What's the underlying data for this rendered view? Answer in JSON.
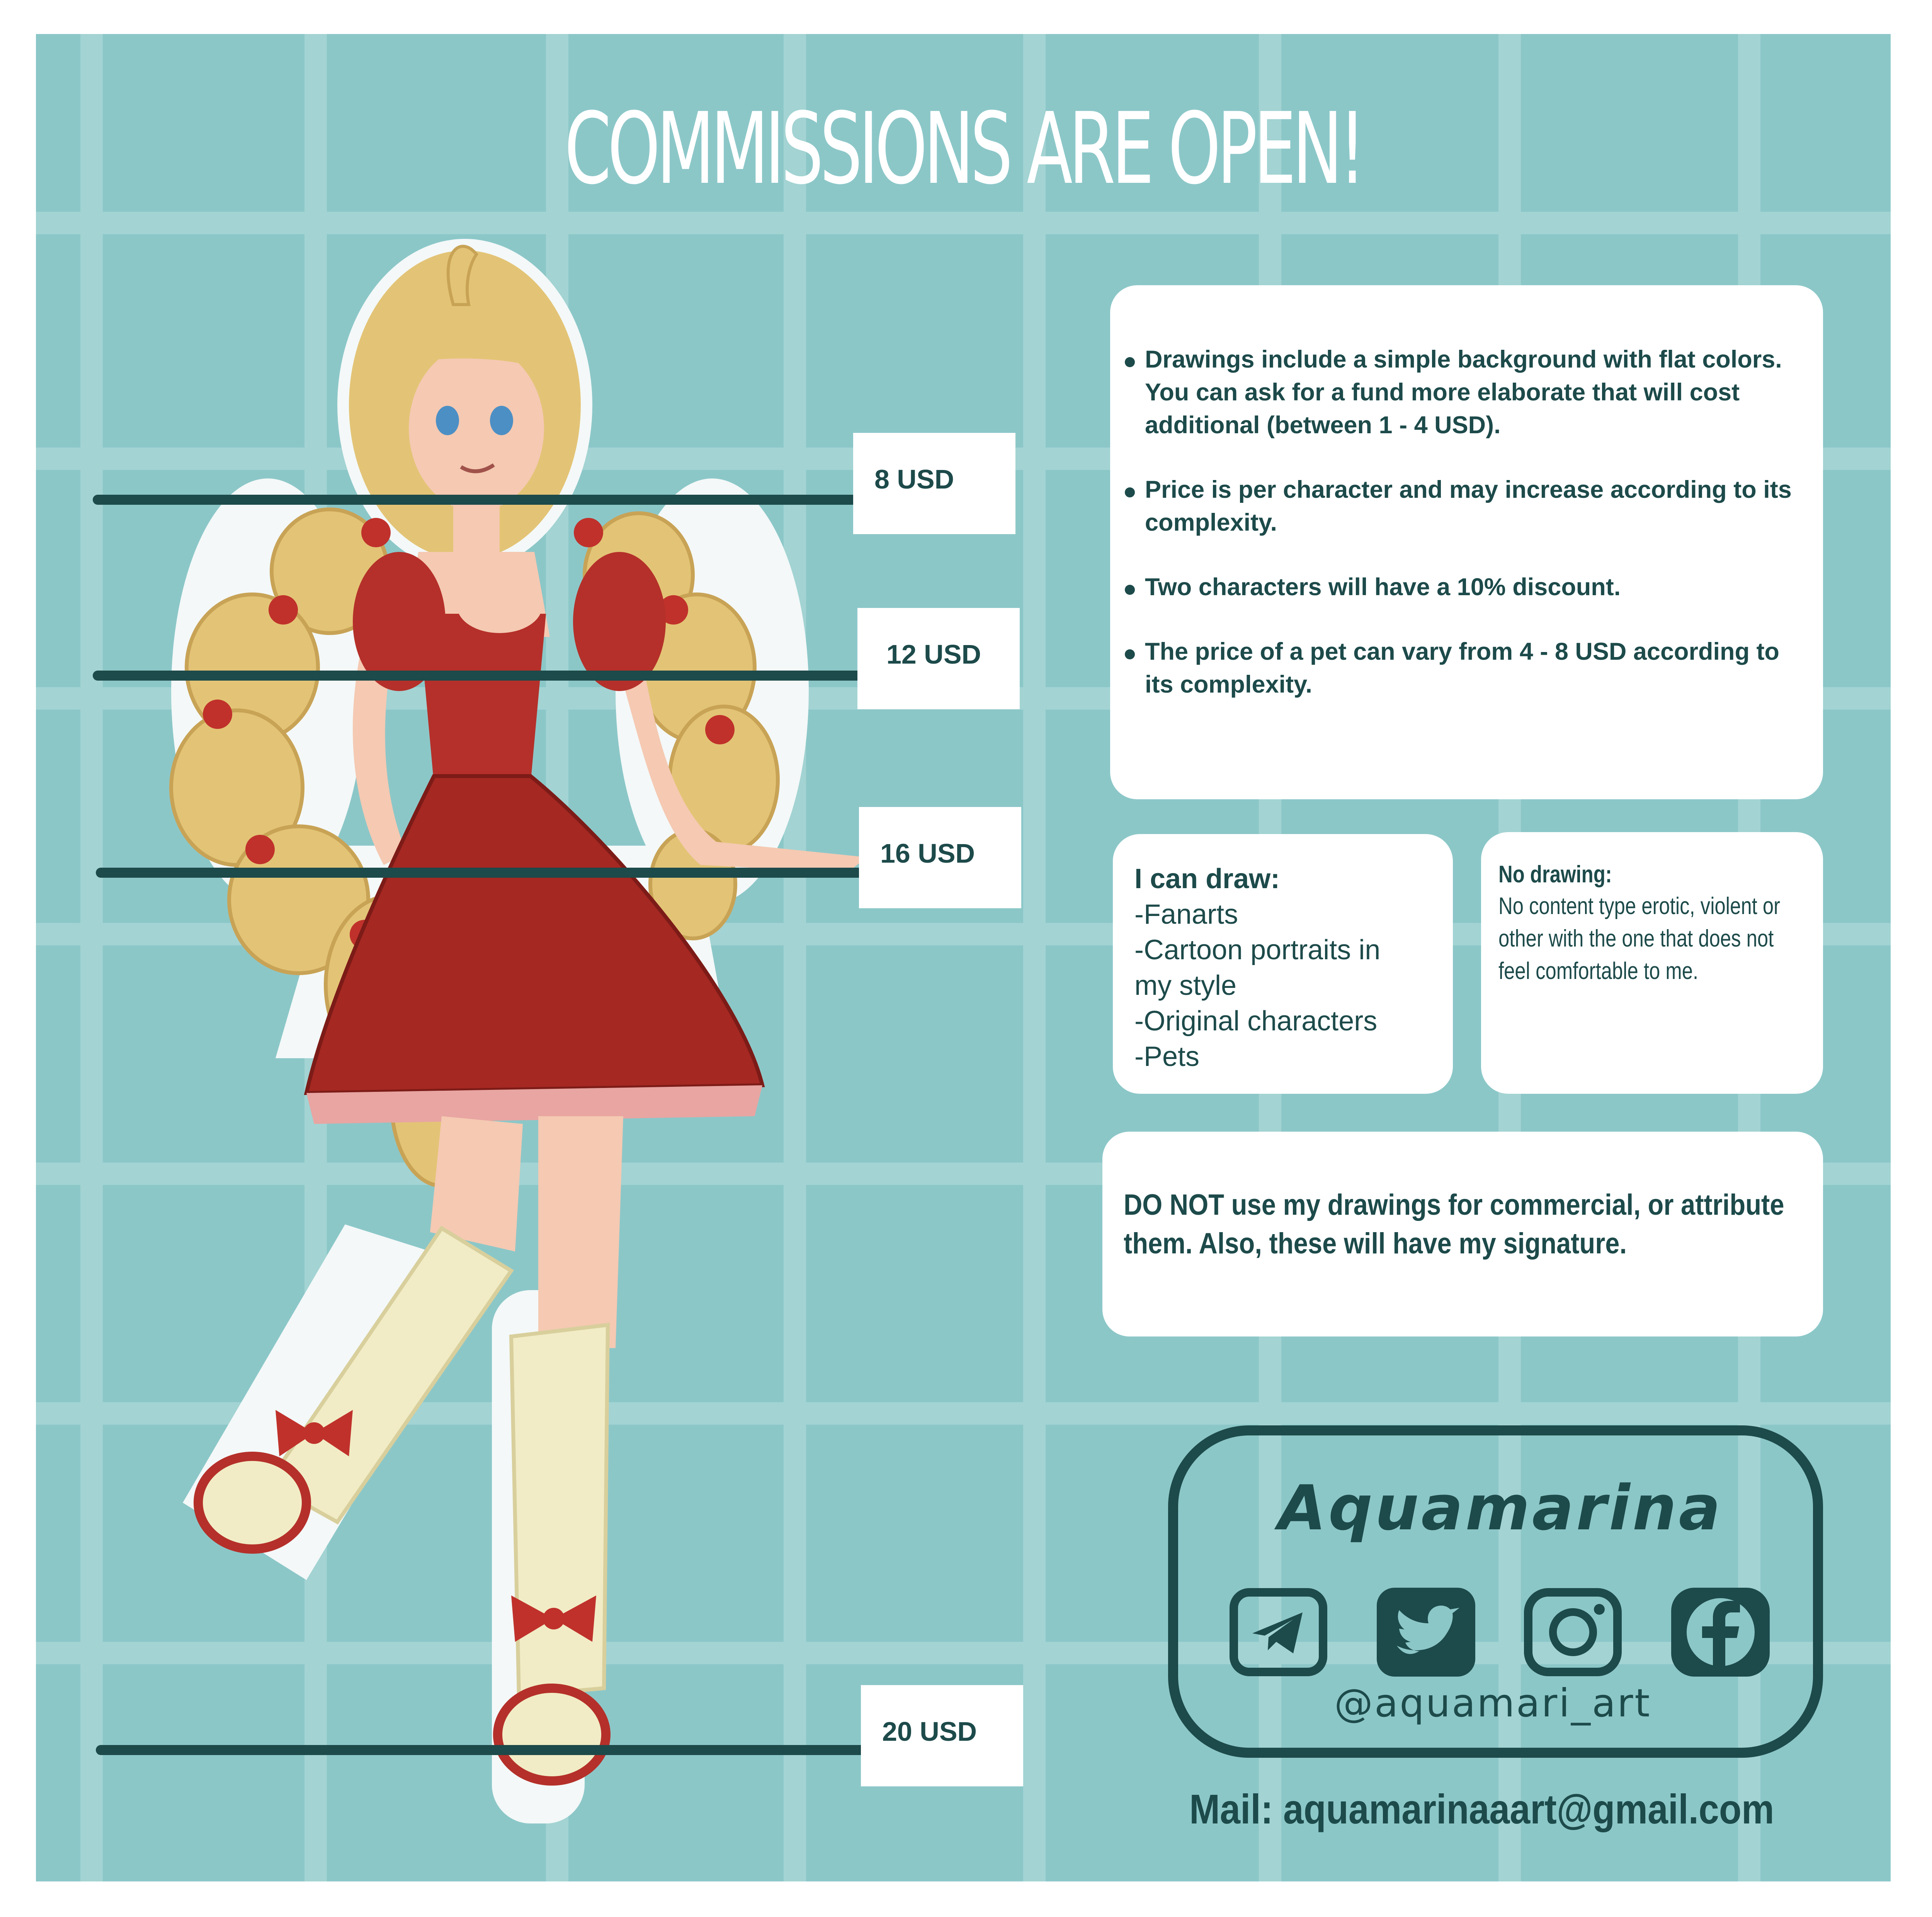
{
  "header": {
    "title": "COMMISSIONS ARE OPEN!"
  },
  "prices": [
    {
      "label": "8 USD"
    },
    {
      "label": "12 USD"
    },
    {
      "label": "16 USD"
    },
    {
      "label": "20 USD"
    }
  ],
  "info": {
    "items": [
      "Drawings include a simple background with flat colors. You can ask for a fund more elaborate that will cost additional (between 1 - 4 USD).",
      "Price is per character and may increase according to its complexity.",
      "Two characters will have a 10% discount.",
      "The price of a pet can vary from 4 - 8 USD according to its complexity."
    ]
  },
  "can_draw": {
    "title": "I can draw:",
    "items": [
      "-Fanarts",
      "-Cartoon portraits in\nmy style",
      "-Original characters",
      "-Pets"
    ]
  },
  "no_drawing": {
    "title": "No drawing:",
    "text": "No content type erotic, violent or other with the one that does not feel comfortable to me."
  },
  "warning": {
    "text": "DO NOT use my drawings for commercial, or attribute them. Also, these will have my signature."
  },
  "social": {
    "brand": "Aquamarina",
    "handle": "@aquamari_art",
    "icons": [
      "telegram-icon",
      "twitter-icon",
      "instagram-icon",
      "facebook-icon"
    ]
  },
  "contact": {
    "mail": "Mail: aquamarinaaart@gmail.com"
  },
  "colors": {
    "background": "#8cc7c8",
    "grid": "#a3d3d3",
    "dark_teal": "#1d4a4a",
    "dress": "#b5302a",
    "hair": "#e3c476"
  }
}
